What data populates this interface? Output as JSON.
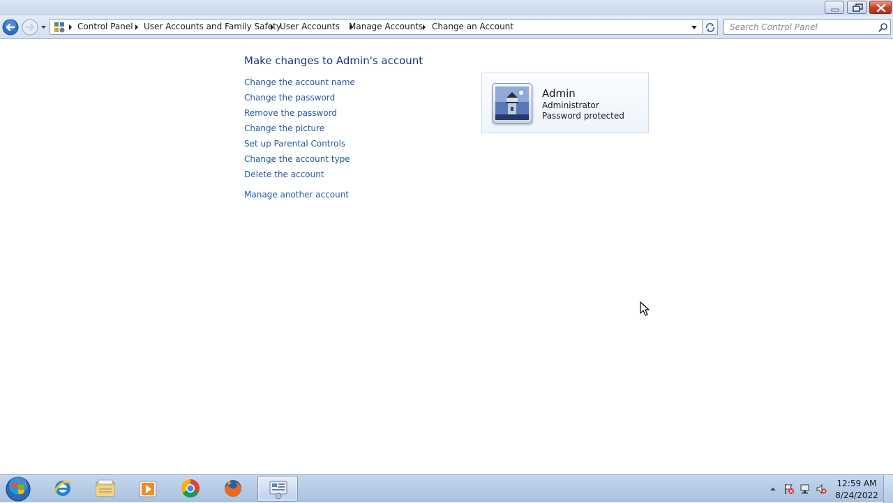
{
  "window": {
    "caption_buttons": [
      "minimize",
      "maximize",
      "close"
    ]
  },
  "navigation": {
    "breadcrumbs": [
      "Control Panel",
      "User Accounts and Family Safety",
      "User Accounts",
      "Manage Accounts",
      "Change an Account"
    ],
    "search_placeholder": "Search Control Panel"
  },
  "main": {
    "title": "Make changes to Admin's account",
    "tasks": [
      "Change the account name",
      "Change the password",
      "Remove the password",
      "Change the picture",
      "Set up Parental Controls",
      "Change the account type",
      "Delete the account"
    ],
    "other_task": "Manage another account"
  },
  "account": {
    "name": "Admin",
    "type": "Administrator",
    "status": "Password protected",
    "picture": "lighthouse-picture"
  },
  "taskbar": {
    "apps": [
      "internet-explorer-icon",
      "windows-explorer-icon",
      "media-player-icon",
      "chrome-icon",
      "firefox-icon",
      "control-panel-icon"
    ],
    "clock_time": "12:59 AM",
    "clock_date": "8/24/2022"
  },
  "colors": {
    "link": "#1e5a9e",
    "title": "#1e3287",
    "taskbar": "#b8cce6"
  }
}
